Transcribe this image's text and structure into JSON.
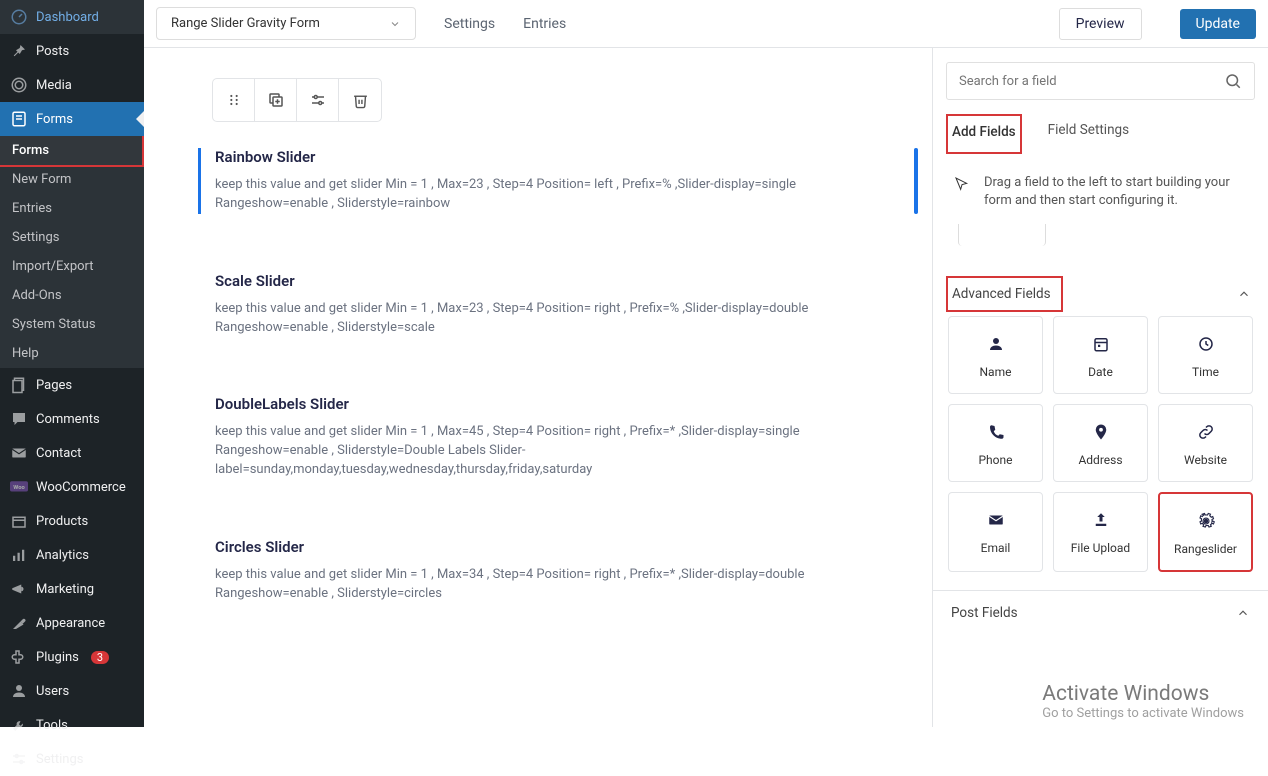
{
  "sidebar": {
    "top": [
      {
        "label": "Dashboard",
        "icon": "dashboard"
      },
      {
        "label": "Posts",
        "icon": "pin"
      },
      {
        "label": "Media",
        "icon": "media"
      },
      {
        "label": "Forms",
        "icon": "forms",
        "active": true,
        "sub": [
          {
            "label": "Forms",
            "highlight": true
          },
          {
            "label": "New Form"
          },
          {
            "label": "Entries"
          },
          {
            "label": "Settings"
          },
          {
            "label": "Import/Export"
          },
          {
            "label": "Add-Ons"
          },
          {
            "label": "System Status"
          },
          {
            "label": "Help"
          }
        ]
      },
      {
        "label": "Pages",
        "icon": "pages"
      },
      {
        "label": "Comments",
        "icon": "comments"
      },
      {
        "label": "Contact",
        "icon": "mail"
      },
      {
        "label": "WooCommerce",
        "icon": "woo"
      },
      {
        "label": "Products",
        "icon": "products"
      },
      {
        "label": "Analytics",
        "icon": "analytics"
      },
      {
        "label": "Marketing",
        "icon": "marketing"
      },
      {
        "label": "Appearance",
        "icon": "appearance"
      },
      {
        "label": "Plugins",
        "icon": "plugins",
        "badge": "3"
      },
      {
        "label": "Users",
        "icon": "users"
      },
      {
        "label": "Tools",
        "icon": "tools"
      },
      {
        "label": "Settings",
        "icon": "settings"
      }
    ]
  },
  "topbar": {
    "form_name": "Range Slider Gravity Form",
    "links": [
      "Settings",
      "Entries"
    ],
    "preview": "Preview",
    "update": "Update"
  },
  "fields": [
    {
      "title": "Rainbow Slider",
      "selected": true,
      "desc": "keep this value and get slider Min = 1 , Max=23 , Step=4 Position= left , Prefix=% ,Slider-display=single Rangeshow=enable , Sliderstyle=rainbow"
    },
    {
      "title": "Scale Slider",
      "desc": "keep this value and get slider Min = 1 , Max=23 , Step=4 Position= right , Prefix=% ,Slider-display=double Rangeshow=enable , Sliderstyle=scale"
    },
    {
      "title": "DoubleLabels Slider",
      "desc": "keep this value and get slider Min = 1 , Max=45 , Step=4 Position= right , Prefix=* ,Slider-display=single Rangeshow=enable , Sliderstyle=Double Labels Slider-label=sunday,monday,tuesday,wednesday,thursday,friday,saturday"
    },
    {
      "title": "Circles Slider",
      "desc": "keep this value and get slider Min = 1 , Max=34 , Step=4 Position= right , Prefix=* ,Slider-display=double Rangeshow=enable , Sliderstyle=circles"
    }
  ],
  "panel": {
    "search_placeholder": "Search for a field",
    "tabs": {
      "add": "Add Fields",
      "settings": "Field Settings"
    },
    "hint": "Drag a field to the left to start building your form and then start configuring it.",
    "group_title": "Advanced Fields",
    "cards": [
      {
        "label": "Name",
        "icon": "person"
      },
      {
        "label": "Date",
        "icon": "date"
      },
      {
        "label": "Time",
        "icon": "time"
      },
      {
        "label": "Phone",
        "icon": "phone"
      },
      {
        "label": "Address",
        "icon": "address"
      },
      {
        "label": "Website",
        "icon": "link"
      },
      {
        "label": "Email",
        "icon": "email"
      },
      {
        "label": "File Upload",
        "icon": "upload"
      },
      {
        "label": "Rangeslider",
        "icon": "gear",
        "highlight": true
      }
    ],
    "footer": "Post Fields"
  },
  "watermark": {
    "title": "Activate Windows",
    "sub": "Go to Settings to activate Windows"
  }
}
